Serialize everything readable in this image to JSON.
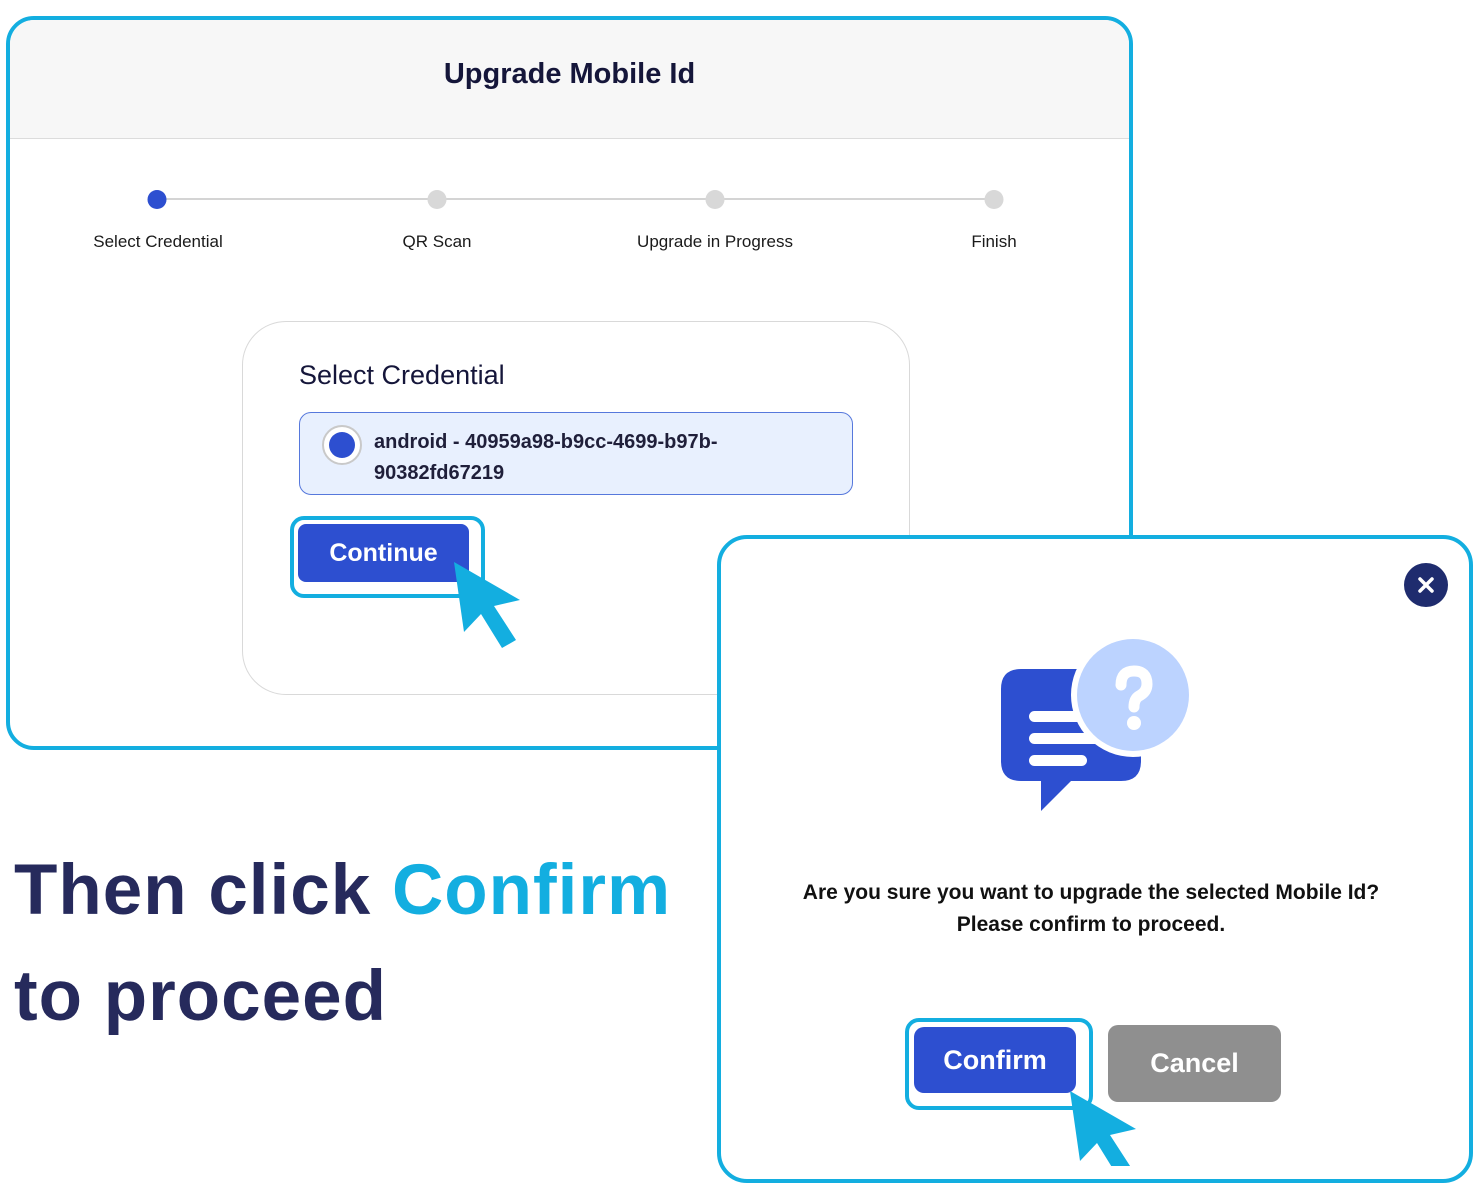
{
  "window": {
    "title": "Upgrade Mobile Id"
  },
  "stepper": {
    "steps": [
      {
        "label": "Select Credential",
        "state": "active"
      },
      {
        "label": "QR Scan",
        "state": "inactive"
      },
      {
        "label": "Upgrade in Progress",
        "state": "inactive"
      },
      {
        "label": "Finish",
        "state": "inactive"
      }
    ]
  },
  "card": {
    "title": "Select Credential",
    "credential_option": "android - 40959a98-b9cc-4699-b97b-90382fd67219",
    "continue_label": "Continue"
  },
  "caption": {
    "part1": "Then click ",
    "highlight": "Confirm",
    "part2": "to proceed"
  },
  "dialog": {
    "close_icon": "close-icon",
    "illustration_icon": "chat-question-icon",
    "message": "Are you sure you want to upgrade the selected Mobile Id? Please confirm to proceed.",
    "confirm_label": "Confirm",
    "cancel_label": "Cancel"
  },
  "colors": {
    "accent": "#2d4fd0",
    "highlight": "#13aee0",
    "caption_text": "#262a5c",
    "cancel": "#8f8f8f"
  }
}
